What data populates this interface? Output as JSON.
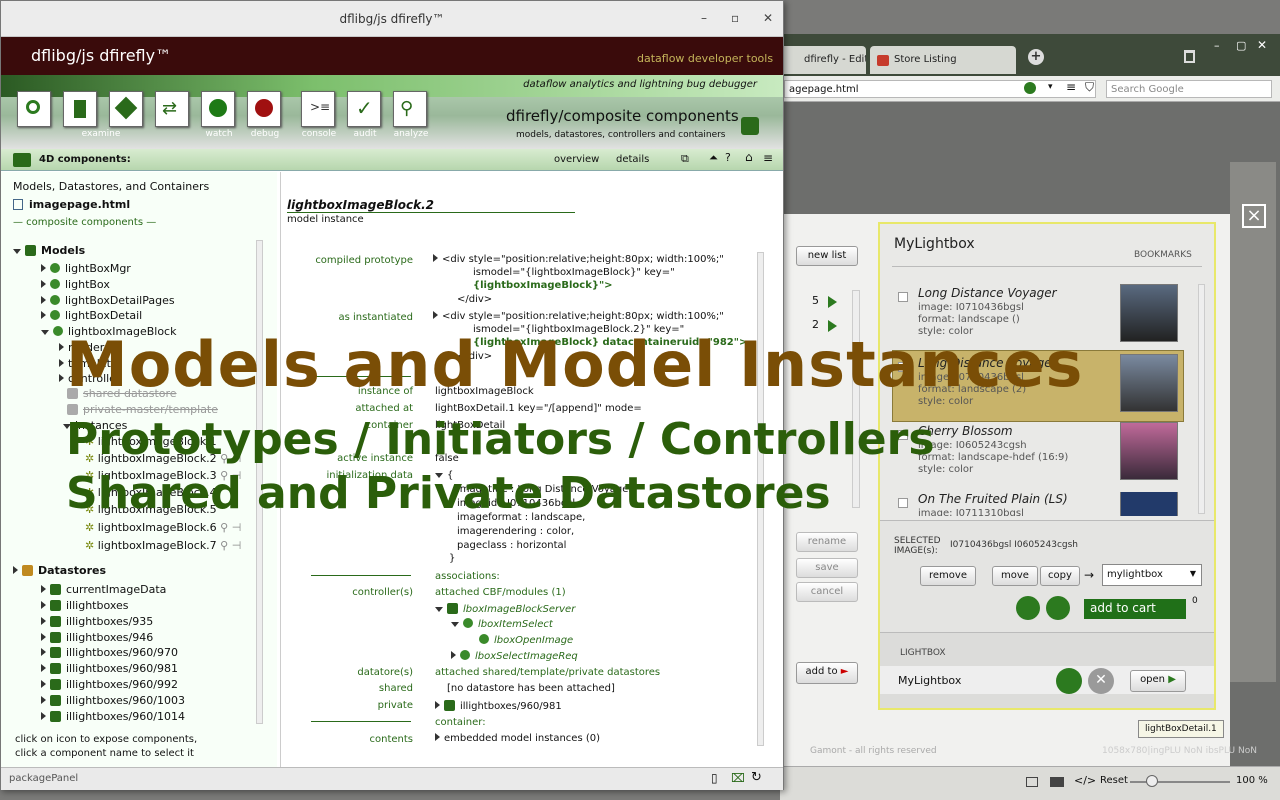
{
  "browser": {
    "tabs": [
      "dfirefly - Edit Item",
      "Store Listing"
    ],
    "url": "agepage.html",
    "search_placeholder": "Search Google",
    "reset_label": "Reset",
    "zoom": "100 %",
    "footer_text": "Gamont - all rights reserved",
    "footer_right": "1058x780|ingPLU NoN ibsPLU NoN"
  },
  "modal": {
    "new_list": "new list",
    "count_5": "5",
    "count_2": "2",
    "rename": "rename",
    "save": "save",
    "cancel": "cancel",
    "add_to": "add to",
    "lightbox_title": "MyLightbox",
    "bookmarks": "BOOKMARKS",
    "items": [
      {
        "title": "Long Distance Voyager",
        "l1": "image: I0710436bgsl",
        "l2": "format: landscape ()",
        "l3": "style: color"
      },
      {
        "title": "Long Distance Voyager",
        "l1": "image: I0710436bgsl",
        "l2": "format: landscape (2)",
        "l3": "style: color"
      },
      {
        "title": "Cherry Blossom",
        "l1": "image: I0605243cgsh",
        "l2": "format: landscape-hdef (16:9)",
        "l3": "style: color"
      },
      {
        "title": "On The Fruited Plain (LS)",
        "l1": "image: I0711310bgsl",
        "l2": "",
        "l3": ""
      }
    ],
    "selected_label": "SELECTED IMAGE(s):",
    "selected_value": "I0710436bgsl I0605243cgsh",
    "remove": "remove",
    "move": "move",
    "copy": "copy",
    "target_list": "mylightbox",
    "add_to_cart": "add to cart",
    "cart_count": "0",
    "lightbox_section": "LIGHTBOX",
    "lightbox_name": "MyLightbox",
    "open": "open",
    "tooltip": "lightBoxDetail.1"
  },
  "firefly": {
    "window_title": "dflibg/js dfirefly™",
    "logo": "dflibg/js  dfirefly™",
    "tagline": "dataflow developer tools",
    "strip": "dataflow analytics and lightning bug debugger",
    "tools": [
      {
        "name": "search",
        "label": ""
      },
      {
        "name": "datastore",
        "label": ""
      },
      {
        "name": "examine",
        "label": "examine"
      },
      {
        "name": "swap",
        "label": ""
      },
      {
        "name": "watch",
        "label": "watch"
      },
      {
        "name": "debug",
        "label": "debug"
      },
      {
        "name": "console",
        "label": "console"
      },
      {
        "name": "audit",
        "label": "audit"
      },
      {
        "name": "analyze",
        "label": "analyze"
      }
    ],
    "composite_title": "dfirefly/composite components",
    "composite_sub": "models, datastores, controllers and containers",
    "crumb": "4D components:",
    "tab_overview": "overview",
    "tab_details": "details",
    "left": {
      "heading": "Models, Datastores, and Containers",
      "file": "imagepage.html",
      "composite": "— composite components —",
      "models_label": "Models",
      "models": [
        "lightBoxMgr",
        "lightBox",
        "lightBoxDetailPages",
        "lightBoxDetail",
        "lightboxImageBlock"
      ],
      "sub": [
        "render",
        "template",
        "controller"
      ],
      "shared": "shared datastore",
      "private": "private-master/template",
      "instances_label": "instances",
      "instances": [
        "lightboxImageBlock.1",
        "lightboxImageBlock.2",
        "lightboxImageBlock.3",
        "lightboxImageBlock.4",
        "lightboxImageBlock.5",
        "lightboxImageBlock.6",
        "lightboxImageBlock.7"
      ],
      "datastores_label": "Datastores",
      "datastores": [
        "currentImageData",
        "illightboxes",
        "illightboxes/935",
        "illightboxes/946",
        "illightboxes/960/970",
        "illightboxes/960/981",
        "illightboxes/960/992",
        "illightboxes/960/1003",
        "illightboxes/960/1014"
      ],
      "hint1": "click on icon to expose components,",
      "hint2": "click a component name to select it"
    },
    "right": {
      "title": "lightboxImageBlock.2",
      "subtitle": "model instance",
      "compiled_label": "compiled prototype",
      "compiled": [
        "<div style=\"position:relative;height:80px; width:100%;\"",
        "ismodel=\"{lightboxImageBlock}\" key=\"",
        "{lightboxImageBlock}\">",
        "</div>"
      ],
      "inst_label": "as instantiated",
      "inst": [
        "<div style=\"position:relative;height:80px; width:100%;\"",
        "ismodel=\"{lightboxImageBlock.2}\" key=\"",
        "{lightboxImageBlock} datacontaineruid=\"982\">",
        "</div>"
      ],
      "instance_of_label": "instance of",
      "instance_of": "lightboxImageBlock",
      "attached_label": "attached at",
      "attached": "lightBoxDetail.1 key=\"/[append]\" mode=",
      "container_label": "container",
      "container": "lightBoxDetail",
      "active_label": "active instance",
      "active": "false",
      "init_label": "initialization data",
      "init": [
        "{",
        "imagetitle : Long Distance Voyager,",
        "imageid : I0710436bgsl,",
        "imageformat : landscape,",
        "imagerendering : color,",
        "pageclass : horizontal",
        "}"
      ],
      "assoc": "associations:",
      "ctrl_label": "controller(s)",
      "ctrl": "attached CBF/modules (1)",
      "ctrl_tree": [
        "lboxImageBlockServer",
        "lboxItemSelect",
        "lboxOpenImage",
        "lboxSelectImageReq"
      ],
      "ds_label": "datatore(s)",
      "ds": "attached shared/template/private datastores",
      "shared_label": "shared",
      "shared": "[no datastore has been attached]",
      "private_label": "private",
      "private": "illightboxes/960/981",
      "container_hdr": "container:",
      "contents_label": "contents",
      "contents": "embedded model instances (0)"
    },
    "panel": "packagePanel"
  },
  "overlay": {
    "line1": "Models and Model Instances",
    "line2": "Prototypes / Initiators / Controllers",
    "line3": "Shared and Private Datastores"
  }
}
